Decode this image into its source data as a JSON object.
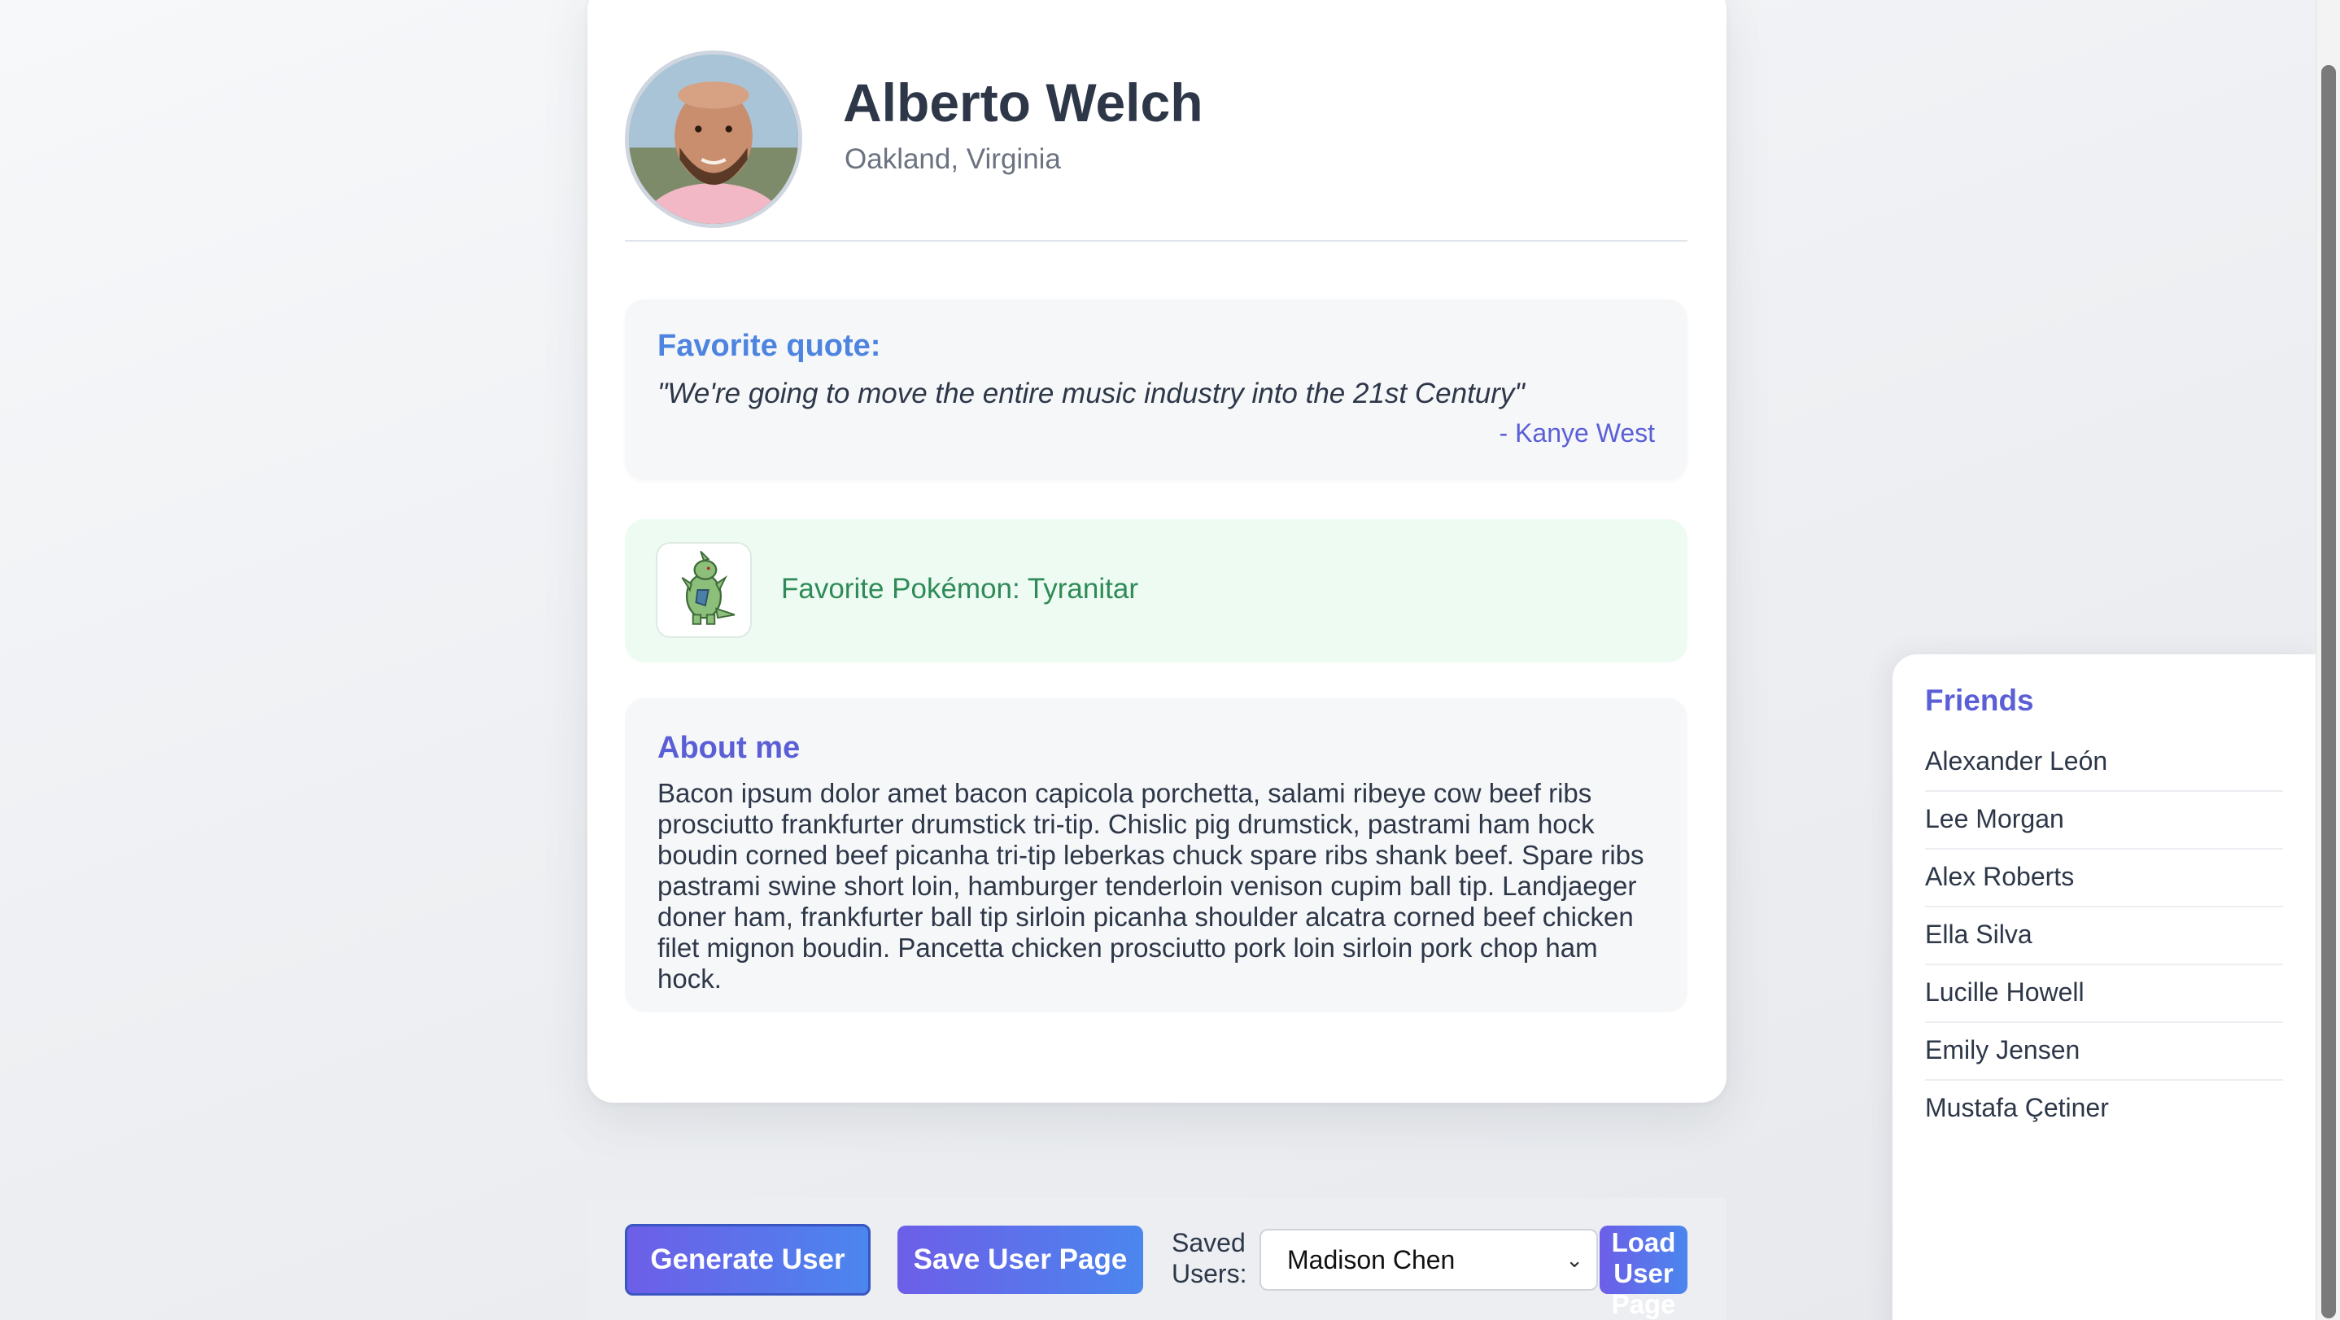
{
  "profile": {
    "name": "Alberto Welch",
    "location": "Oakland, Virginia"
  },
  "quote": {
    "title": "Favorite quote:",
    "text": "\"We're going to move the entire music industry into the 21st Century\"",
    "author": "- Kanye West"
  },
  "pokemon": {
    "label": "Favorite Pokémon: Tyranitar"
  },
  "about": {
    "title": "About me",
    "text": "Bacon ipsum dolor amet bacon capicola porchetta, salami ribeye cow beef ribs prosciutto frankfurter drumstick tri-tip. Chislic pig drumstick, pastrami ham hock boudin corned beef picanha tri-tip leberkas chuck spare ribs shank beef. Spare ribs pastrami swine short loin, hamburger tenderloin venison cupim ball tip. Landjaeger doner ham, frankfurter ball tip sirloin picanha shoulder alcatra corned beef chicken filet mignon boudin. Pancetta chicken prosciutto pork loin sirloin pork chop ham hock."
  },
  "toolbar": {
    "generate_label": "Generate User",
    "save_label": "Save User Page",
    "saved_users_label": "Saved Users:",
    "saved_users_selected": "Madison Chen",
    "load_label": "Load User Page"
  },
  "friends": {
    "title": "Friends",
    "items": [
      "Alexander León",
      "Lee Morgan",
      "Alex Roberts",
      "Ella Silva",
      "Lucille Howell",
      "Emily Jensen",
      "Mustafa Çetiner"
    ]
  },
  "icons": {
    "avatar": "profile-photo",
    "pokemon": "tyranitar-sprite",
    "select": "chevron-down-icon"
  },
  "colors": {
    "accent_blue": "#4c84e0",
    "accent_purple": "#5b5fd6",
    "pokemon_green": "#2e8b57",
    "button_gradient_start": "#6d5ee8",
    "button_gradient_end": "#4b86ee"
  }
}
